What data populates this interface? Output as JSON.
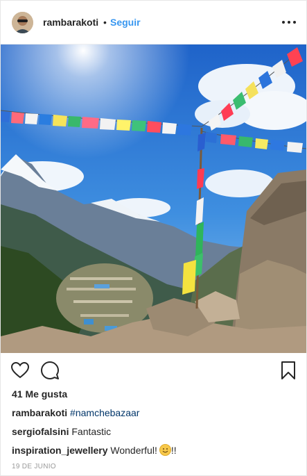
{
  "post": {
    "username": "rambarakoti",
    "separator": "•",
    "follow_label": "Seguir",
    "likes_text": "41 Me gusta",
    "date": "19 DE JUNIO"
  },
  "comments": [
    {
      "user": "rambarakoti",
      "text": "#namchebazaar"
    },
    {
      "user": "sergiofalsini",
      "text": "Fantastic"
    },
    {
      "user": "inspiration_jewellery",
      "text": "Wonderful!",
      "suffix": "!!"
    }
  ],
  "icons": {
    "more": "more-options-icon",
    "like": "heart-icon",
    "comment": "comment-bubble-icon",
    "save": "bookmark-icon",
    "emoji": "smiling-face-emoji"
  },
  "colors": {
    "link_blue": "#3897f0",
    "hashtag": "#003569",
    "text": "#262626",
    "muted": "#999999"
  }
}
